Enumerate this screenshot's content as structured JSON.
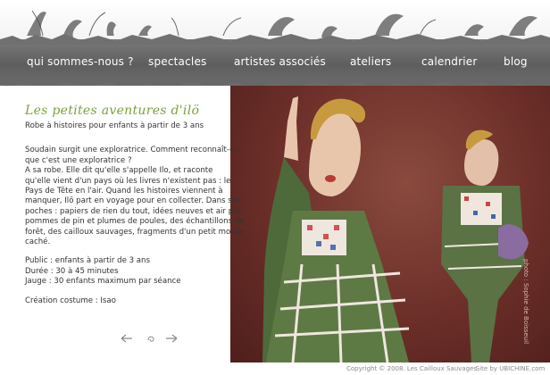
{
  "nav": {
    "items": [
      {
        "label": "qui sommes-nous ?"
      },
      {
        "label": "spectacles"
      },
      {
        "label": "artistes associés"
      },
      {
        "label": "ateliers"
      },
      {
        "label": "calendrier"
      },
      {
        "label": "blog"
      }
    ]
  },
  "content": {
    "title": "Les petites aventures d'ilö",
    "subtitle": "Robe à histoires pour enfants à partir de 3 ans",
    "paragraph1": [
      "Soudain surgit une exploratrice. Comment reconnaît-on",
      "que c'est une exploratrice ?",
      "A sa robe. Elle dit qu'elle s'appelle Ilo, et raconte",
      "qu'elle vient d'un pays où les livres n'existent pas : le",
      "Pays de Tête en l'air. Quand les histoires viennent à",
      "manquer, Ilö part en voyage pour en collecter. Dans ses",
      "poches : papiers de rien du tout, idées neuves et air pur,",
      "pommes de pin et plumes de poules, des échantillons de",
      "forêt, des cailloux sauvages, fragments d'un petit monde",
      "caché."
    ],
    "details": [
      "Public : enfants à partir de 3 ans",
      "Durée : 30 à 45 minutes",
      "Jauge : 30 enfants maximum par séance"
    ],
    "costume": "Création costume : Isao"
  },
  "photo": {
    "credit": "photo : Sophie de Boisseuil"
  },
  "footer": {
    "copyright": "Copyright © 2008. Les Cailloux Sauvages",
    "site_by": "- Site by UBICHINE.com"
  },
  "colors": {
    "accent": "#7aa13a",
    "nav_bg": "#6a6a6a",
    "photo_bg": "#6b2e28"
  },
  "icons": [
    "prev-arrow-icon",
    "swirl-icon",
    "next-arrow-icon"
  ]
}
